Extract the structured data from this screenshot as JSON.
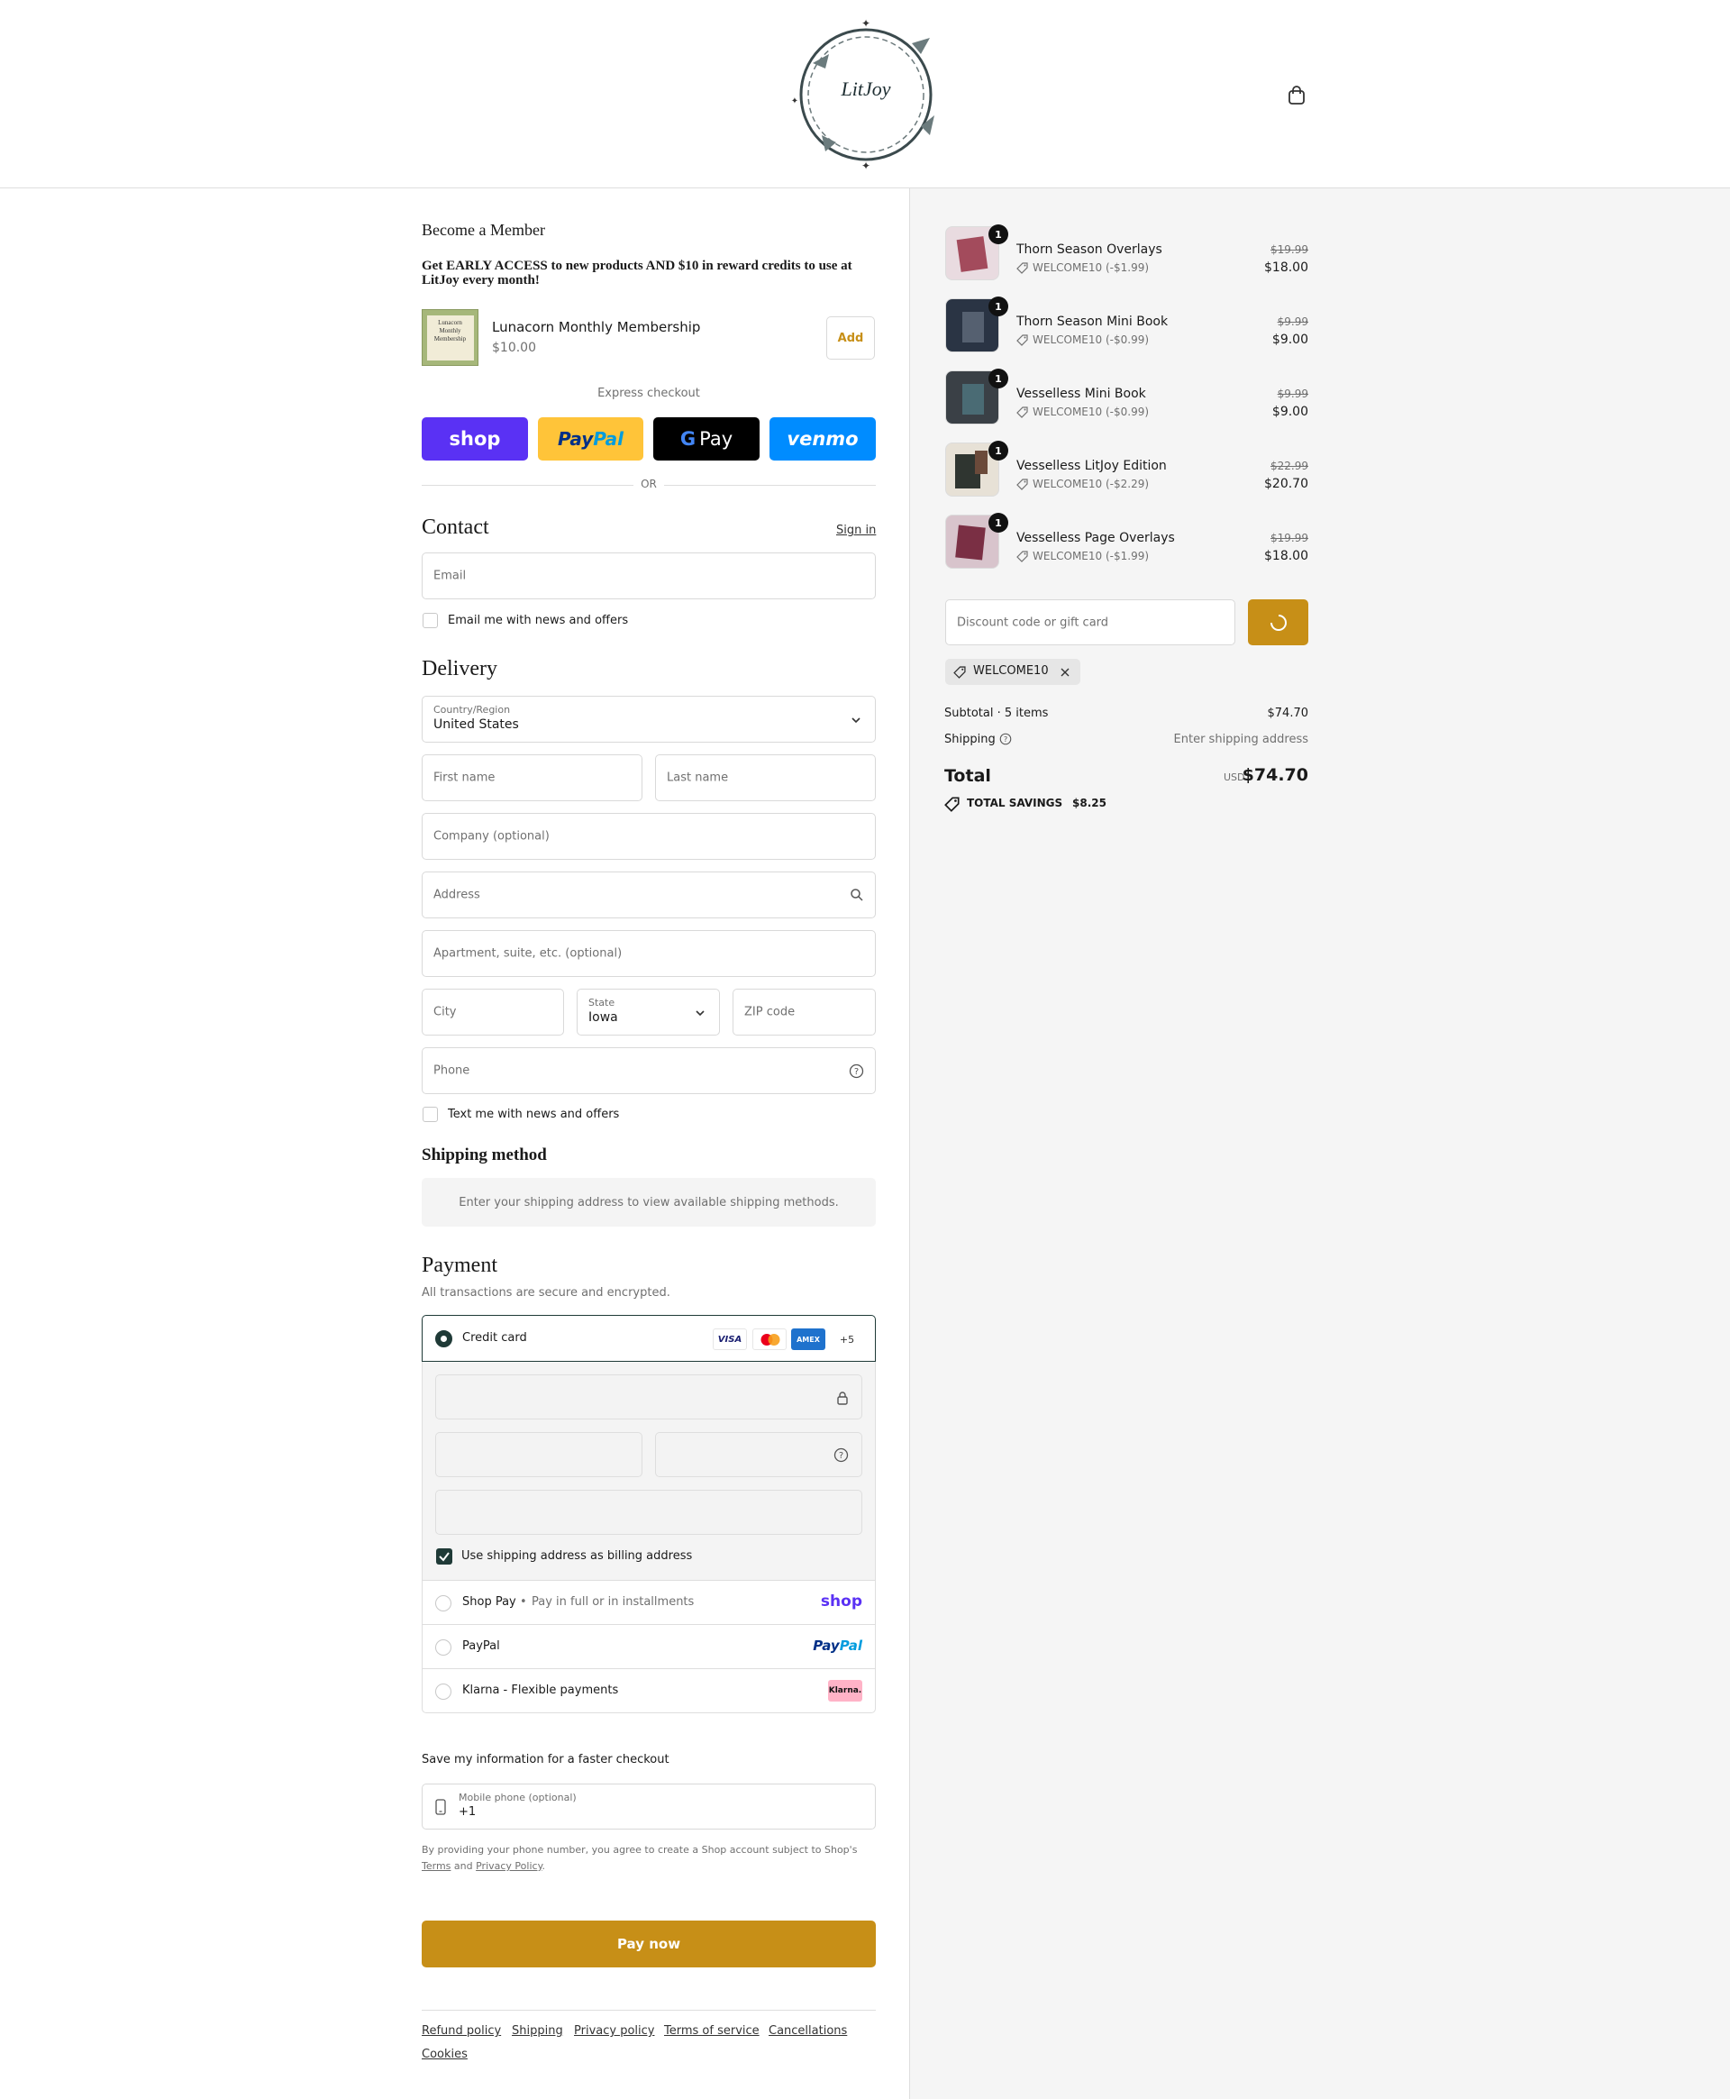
{
  "header": {
    "logo_text": "LitJoy",
    "cart_icon": "shopping-bag-icon"
  },
  "membership": {
    "title": "Become a Member",
    "promo": "Get EARLY ACCESS to new products AND $10 in reward credits to use at LitJoy every month!",
    "thumb_text": "Lunacorn Monthly Membership",
    "product_name": "Lunacorn Monthly Membership",
    "price": "$10.00",
    "add_label": "Add"
  },
  "express": {
    "label": "Express checkout",
    "shop_label": "shop",
    "paypal_label_1": "Pay",
    "paypal_label_2": "Pal",
    "gpay_label": "Pay",
    "venmo_label": "venmo",
    "or_label": "OR"
  },
  "contact": {
    "title": "Contact",
    "signin": "Sign in",
    "email_placeholder": "Email",
    "news_label": "Email me with news and offers"
  },
  "delivery": {
    "title": "Delivery",
    "country_label": "Country/Region",
    "country_value": "United States",
    "first_name": "First name",
    "last_name": "Last name",
    "company": "Company (optional)",
    "address": "Address",
    "apartment": "Apartment, suite, etc. (optional)",
    "city": "City",
    "state_label": "State",
    "state_value": "Iowa",
    "zip": "ZIP code",
    "phone": "Phone",
    "text_news_label": "Text me with news and offers"
  },
  "shipping_method": {
    "title": "Shipping method",
    "notice": "Enter your shipping address to view available shipping methods."
  },
  "payment": {
    "title": "Payment",
    "subtitle": "All transactions are secure and encrypted.",
    "credit_card_label": "Credit card",
    "visa": "VISA",
    "amex": "AMEX",
    "more_cards": "+5",
    "billing_label": "Use shipping address as billing address",
    "shop_pay_label": "Shop Pay",
    "shop_pay_sub": "Pay in full or in installments",
    "shop_pay_logo": "shop",
    "paypal_label": "PayPal",
    "paypal_logo_1": "Pay",
    "paypal_logo_2": "Pal",
    "klarna_label": "Klarna - Flexible payments",
    "klarna_logo": "Klarna."
  },
  "save_info": {
    "title": "Save my information for a faster checkout",
    "mobile_label": "Mobile phone (optional)",
    "mobile_value": "+1",
    "legal_prefix": "By providing your phone number, you agree to create a Shop account subject to Shop's",
    "terms": "Terms",
    "and": "and",
    "privacy": "Privacy Policy",
    "period": "."
  },
  "pay_now": "Pay now",
  "footer_links": [
    "Refund policy",
    "Shipping",
    "Privacy policy",
    "Terms of service",
    "Cancellations",
    "Cookies"
  ],
  "order": {
    "items": [
      {
        "name": "Thorn Season Overlays",
        "discount": "WELCOME10 (-$1.99)",
        "original": "$19.99",
        "price": "$18.00",
        "qty": "1"
      },
      {
        "name": "Thorn Season Mini Book",
        "discount": "WELCOME10 (-$0.99)",
        "original": "$9.99",
        "price": "$9.00",
        "qty": "1"
      },
      {
        "name": "Vesselless Mini Book",
        "discount": "WELCOME10 (-$0.99)",
        "original": "$9.99",
        "price": "$9.00",
        "qty": "1"
      },
      {
        "name": "Vesselless LitJoy Edition",
        "discount": "WELCOME10 (-$2.29)",
        "original": "$22.99",
        "price": "$20.70",
        "qty": "1"
      },
      {
        "name": "Vesselless Page Overlays",
        "discount": "WELCOME10 (-$1.99)",
        "original": "$19.99",
        "price": "$18.00",
        "qty": "1"
      }
    ],
    "discount_placeholder": "Discount code or gift card",
    "applied_code": "WELCOME10",
    "subtotal_label": "Subtotal · 5 items",
    "subtotal_value": "$74.70",
    "shipping_label": "Shipping",
    "shipping_value": "Enter shipping address",
    "total_label": "Total",
    "currency": "USD",
    "total_value": "$74.70",
    "savings_label": "TOTAL SAVINGS",
    "savings_value": "$8.25"
  },
  "colors": {
    "accent": "#c78f17",
    "shop_purple": "#5a31f4",
    "paypal_yellow": "#ffc439",
    "venmo_blue": "#008cff",
    "dark_green": "#1f3a37"
  }
}
